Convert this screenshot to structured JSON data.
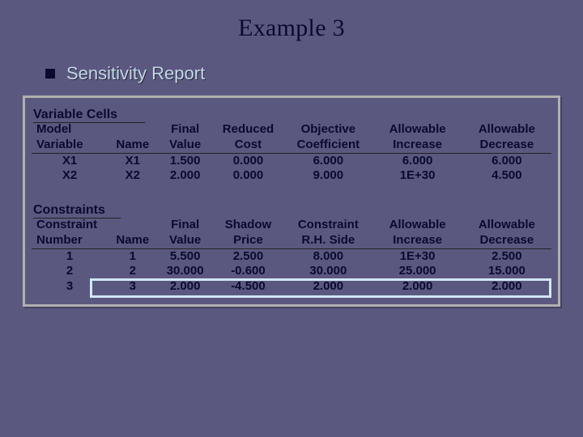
{
  "title": "Example 3",
  "subhead": "Sensitivity Report",
  "sections": {
    "variableCells": {
      "label": "Variable Cells",
      "head": {
        "c1a": "Model",
        "c1b": "Variable",
        "c2a": "",
        "c2b": "Name",
        "c3a": "Final",
        "c3b": "Value",
        "c4a": "Reduced",
        "c4b": "Cost",
        "c5a": "Objective",
        "c5b": "Coefficient",
        "c6a": "Allowable",
        "c6b": "Increase",
        "c7a": "Allowable",
        "c7b": "Decrease"
      },
      "rows": [
        {
          "modelVar": "X1",
          "name": "X1",
          "finalValue": "1.500",
          "reducedCost": "0.000",
          "objCoef": "6.000",
          "allowInc": "6.000",
          "allowDec": "6.000"
        },
        {
          "modelVar": "X2",
          "name": "X2",
          "finalValue": "2.000",
          "reducedCost": "0.000",
          "objCoef": "9.000",
          "allowInc": "1E+30",
          "allowDec": "4.500"
        }
      ]
    },
    "constraints": {
      "label": "Constraints",
      "head": {
        "c1a": "Constraint",
        "c1b": "Number",
        "c2a": "",
        "c2b": "Name",
        "c3a": "Final",
        "c3b": "Value",
        "c4a": "Shadow",
        "c4b": "Price",
        "c5a": "Constraint",
        "c5b": "R.H. Side",
        "c6a": "Allowable",
        "c6b": "Increase",
        "c7a": "Allowable",
        "c7b": "Decrease"
      },
      "rows": [
        {
          "num": "1",
          "name": "1",
          "finalValue": "5.500",
          "shadowPrice": "2.500",
          "rhs": "8.000",
          "allowInc": "1E+30",
          "allowDec": "2.500"
        },
        {
          "num": "2",
          "name": "2",
          "finalValue": "30.000",
          "shadowPrice": "-0.600",
          "rhs": "30.000",
          "allowInc": "25.000",
          "allowDec": "15.000"
        },
        {
          "num": "3",
          "name": "3",
          "finalValue": "2.000",
          "shadowPrice": "-4.500",
          "rhs": "2.000",
          "allowInc": "2.000",
          "allowDec": "2.000"
        }
      ]
    }
  },
  "chart_data": [
    {
      "type": "table",
      "title": "Variable Cells",
      "columns": [
        "Model Variable",
        "Name",
        "Final Value",
        "Reduced Cost",
        "Objective Coefficient",
        "Allowable Increase",
        "Allowable Decrease"
      ],
      "rows": [
        [
          "X1",
          "X1",
          1.5,
          0.0,
          6.0,
          6.0,
          6.0
        ],
        [
          "X2",
          "X2",
          2.0,
          0.0,
          9.0,
          "1E+30",
          4.5
        ]
      ]
    },
    {
      "type": "table",
      "title": "Constraints",
      "columns": [
        "Constraint Number",
        "Name",
        "Final Value",
        "Shadow Price",
        "Constraint R.H. Side",
        "Allowable Increase",
        "Allowable Decrease"
      ],
      "rows": [
        [
          "1",
          "1",
          5.5,
          2.5,
          8.0,
          "1E+30",
          2.5
        ],
        [
          "2",
          "2",
          30.0,
          -0.6,
          30.0,
          25.0,
          15.0
        ],
        [
          "3",
          "3",
          2.0,
          -4.5,
          2.0,
          2.0,
          2.0
        ]
      ]
    }
  ]
}
